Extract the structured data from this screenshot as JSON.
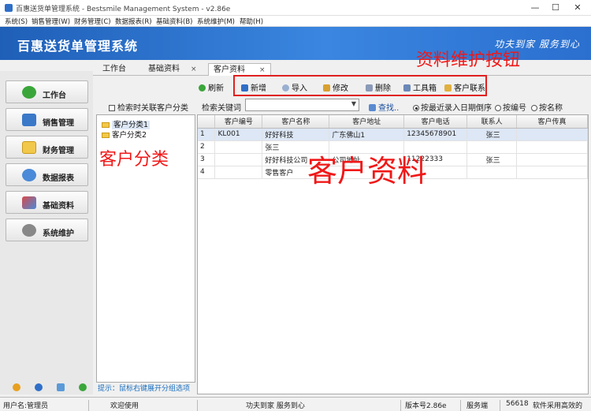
{
  "window": {
    "title": "百惠送货单管理系统 - Bestsmile Management System - v2.86e",
    "minimize": "—",
    "maximize": "☐",
    "close": "✕"
  },
  "menu": [
    "系统(S)",
    "销售管理(W)",
    "财务管理(C)",
    "数据报表(R)",
    "基础资料(B)",
    "系统维护(M)",
    "帮助(H)"
  ],
  "banner": {
    "title": "百惠送货单管理系统",
    "slogan": "功夫到家 服务到心"
  },
  "nav": [
    {
      "label": "工作台",
      "icon": "check-icon",
      "color": "#3aa63a"
    },
    {
      "label": "销售管理",
      "icon": "sales-icon",
      "color": "#3a78c8"
    },
    {
      "label": "财务管理",
      "icon": "folder-icon",
      "color": "#f2c84a"
    },
    {
      "label": "数据报表",
      "icon": "magnifier-icon",
      "color": "#4a8ad8"
    },
    {
      "label": "基础资料",
      "icon": "pyramid-icon",
      "color": "#d84a4a"
    },
    {
      "label": "系统维护",
      "icon": "gear-icon",
      "color": "#888888"
    }
  ],
  "tabs": [
    {
      "label": "工作台"
    },
    {
      "label": "基础资料",
      "close": "×"
    },
    {
      "label": "客户资料",
      "close": "×"
    }
  ],
  "toolbar": {
    "refresh": "刷新",
    "add": "新增",
    "import": "导入",
    "edit": "修改",
    "delete": "删除",
    "tools": "工具箱",
    "contact": "客户联系"
  },
  "search": {
    "checkbox_label": "检索时关联客户分类",
    "keyword_label": "检索关键词",
    "find": "查找..",
    "sort_options": [
      "按最近录入日期倒序",
      "按编号",
      "按名称"
    ]
  },
  "tree": {
    "items": [
      "客户分类1",
      "客户分类2"
    ]
  },
  "hint": "提示：鼠标右键展开分组选项",
  "table": {
    "columns": [
      "客户编号",
      "客户名称",
      "客户地址",
      "客户电话",
      "联系人",
      "客户传真"
    ],
    "rows": [
      {
        "n": "1",
        "cells": [
          "KL001",
          "好好科技",
          "广东佛山1",
          "12345678901",
          "张三",
          ""
        ]
      },
      {
        "n": "2",
        "cells": [
          "",
          "张三",
          "",
          "",
          "",
          ""
        ]
      },
      {
        "n": "3",
        "cells": [
          "",
          "好好科技公司",
          "公司地址",
          "11222333",
          "张三",
          ""
        ]
      },
      {
        "n": "4",
        "cells": [
          "",
          "零售客户",
          "",
          "",
          "",
          ""
        ]
      }
    ]
  },
  "status": {
    "user": "用户名:管理员",
    "welcome": "欢迎使用",
    "motto": "功夫到家 服务到心",
    "version": "版本号2.86e",
    "service": "服务端",
    "code": "56618",
    "soft": "软件采用高效的"
  },
  "annotations": {
    "buttons": "资料维护按钮",
    "category": "客户分类",
    "data": "客户资料"
  },
  "colors": {
    "banner": "#2b6fcf",
    "annotation": "#f01818",
    "hint": "#1a6fc0"
  }
}
